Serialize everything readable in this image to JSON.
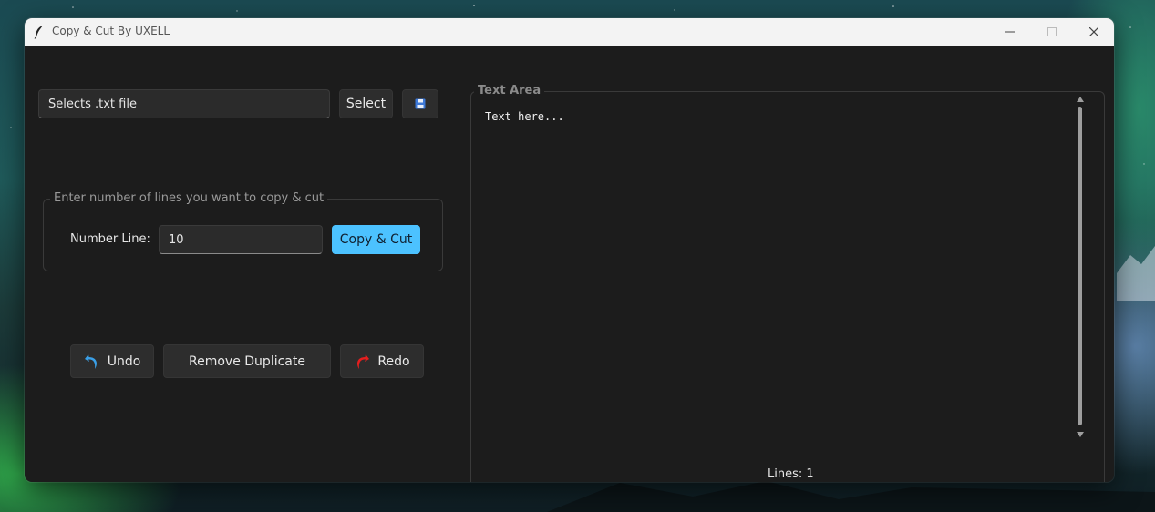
{
  "window": {
    "title": "Copy & Cut By UXELL",
    "controls": {
      "minimize": "—",
      "maximize": "☐",
      "close": "✕"
    }
  },
  "file_select": {
    "placeholder": "Selects .txt file",
    "select_label": "Select",
    "save_icon": "save-icon"
  },
  "lines_group": {
    "legend": "Enter number of lines you want to copy & cut",
    "number_line_label": "Number Line:",
    "number_line_value": "10",
    "copy_cut_label": "Copy & Cut"
  },
  "actions": {
    "undo_label": "Undo",
    "remove_duplicate_label": "Remove Duplicate",
    "redo_label": "Redo"
  },
  "text_area": {
    "legend": "Text Area",
    "content": "Text here...",
    "lines_status": "Lines: 1"
  },
  "colors": {
    "accent": "#4cc2ff",
    "undo_arrow": "#3aa0e8",
    "redo_arrow": "#e51e1e"
  }
}
